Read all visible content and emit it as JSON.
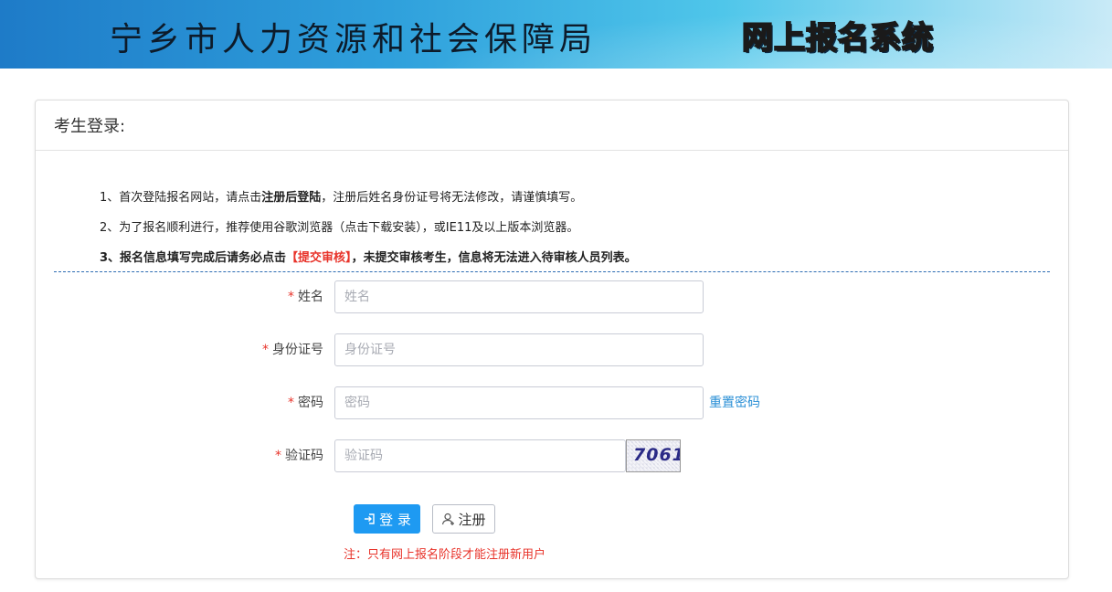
{
  "header": {
    "org_name": "宁乡市人力资源和社会保障局",
    "system_chars": [
      "网",
      "上",
      "报",
      "名",
      "系",
      "统"
    ]
  },
  "panel": {
    "title": "考生登录:"
  },
  "notes": {
    "line1_prefix": "1、首次登陆报名网站，请点击",
    "line1_bold": "注册后登陆",
    "line1_suffix": "，注册后姓名身份证号将无法修改，请谨慎填写。",
    "line2": "2、为了报名顺利进行，推荐使用谷歌浏览器（点击下载安装），或IE11及以上版本浏览器。",
    "line3_prefix": "3、报名信息填写完成后请务必点击",
    "line3_red": "【提交审核】",
    "line3_suffix": "，未提交审核考生，信息将无法进入待审核人员列表。"
  },
  "form": {
    "required_mark": "*",
    "name": {
      "label": "姓名",
      "placeholder": "姓名",
      "value": ""
    },
    "id_number": {
      "label": "身份证号",
      "placeholder": "身份证号",
      "value": ""
    },
    "password": {
      "label": "密码",
      "placeholder": "密码",
      "value": "",
      "reset_link": "重置密码"
    },
    "captcha": {
      "label": "验证码",
      "placeholder": "验证码",
      "value": "",
      "image_code": "7061"
    }
  },
  "buttons": {
    "login_label": "登 录",
    "register_label": "注册"
  },
  "footer_note": "注：只有网上报名阶段才能注册新用户",
  "colors": {
    "accent_blue": "#1e9af2",
    "link_blue": "#2a8fd6",
    "required_red": "#e8332a",
    "divider_blue": "#2d6db3"
  }
}
